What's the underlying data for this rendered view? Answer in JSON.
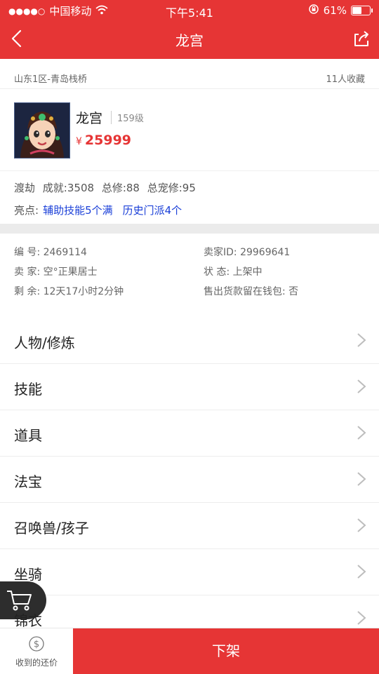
{
  "status_bar": {
    "carrier": "中国移动",
    "time": "下午5:41",
    "battery_percent": "61%",
    "battery_level": 0.61
  },
  "nav": {
    "title": "龙宫"
  },
  "server": {
    "location": "山东1区-青岛栈桥",
    "favorites": "11人收藏"
  },
  "character": {
    "name": "龙宫",
    "level": "159级",
    "price_symbol": "¥",
    "price": "25999"
  },
  "stats": {
    "dujie": "渡劫",
    "achievement": "成就:3508",
    "total_cultivation": "总修:88",
    "pet_cultivation": "总宠修:95"
  },
  "highlights": {
    "label": "亮点:",
    "tags": [
      "辅助技能5个满",
      "历史门派4个"
    ]
  },
  "details": {
    "serial": "编  号: 2469114",
    "seller_id": "卖家ID: 29969641",
    "seller": "卖  家: 空°正果居士",
    "status": "状  态: 上架中",
    "remaining": "剩  余: 12天17小时2分钟",
    "wallet": "售出货款留在钱包: 否"
  },
  "menu": [
    {
      "label": "人物/修炼"
    },
    {
      "label": "技能"
    },
    {
      "label": "道具"
    },
    {
      "label": "法宝"
    },
    {
      "label": "召唤兽/孩子"
    },
    {
      "label": "坐骑"
    },
    {
      "label": "锦衣"
    }
  ],
  "bottom": {
    "counter_offer_label": "收到的还价",
    "delist_label": "下架"
  },
  "colors": {
    "accent": "#e63535",
    "link": "#1a3fd8"
  }
}
